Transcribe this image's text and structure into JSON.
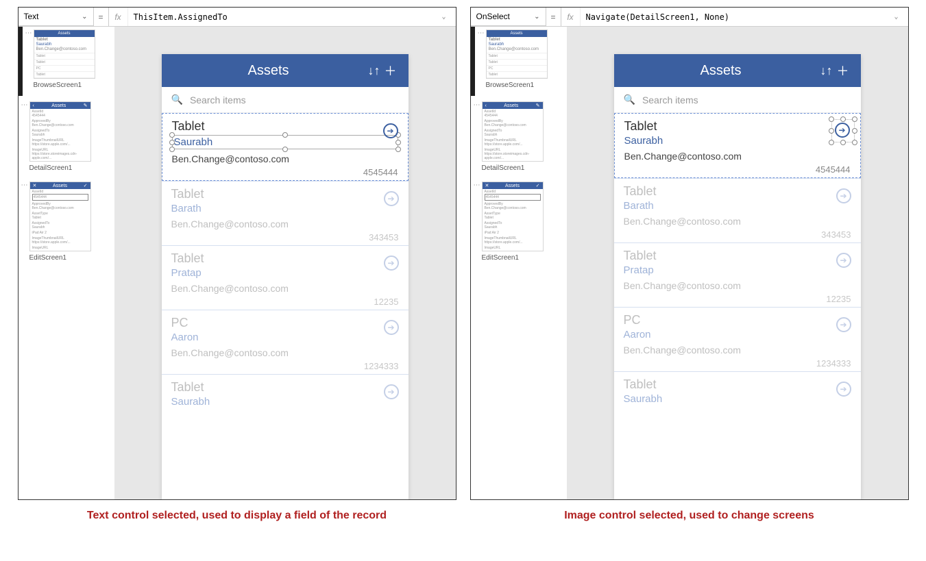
{
  "left": {
    "property": "Text",
    "formula": "ThisItem.AssignedTo",
    "caption": "Text control selected, used to display a field of the record"
  },
  "right": {
    "property": "OnSelect",
    "formula": "Navigate(DetailScreen1, None)",
    "caption": "Image control selected, used to change screens"
  },
  "screens": {
    "s1": "BrowseScreen1",
    "s2": "DetailScreen1",
    "s3": "EditScreen1",
    "thumb_title": "Assets"
  },
  "app": {
    "title": "Assets",
    "search_placeholder": "Search items"
  },
  "records": [
    {
      "title": "Tablet",
      "name": "Saurabh",
      "email": "Ben.Change@contoso.com",
      "num": "4545444"
    },
    {
      "title": "Tablet",
      "name": "Barath",
      "email": "Ben.Change@contoso.com",
      "num": "343453"
    },
    {
      "title": "Tablet",
      "name": "Pratap",
      "email": "Ben.Change@contoso.com",
      "num": "12235"
    },
    {
      "title": "PC",
      "name": "Aaron",
      "email": "Ben.Change@contoso.com",
      "num": "1234333"
    },
    {
      "title": "Tablet",
      "name": "Saurabh",
      "email": "",
      "num": ""
    }
  ]
}
